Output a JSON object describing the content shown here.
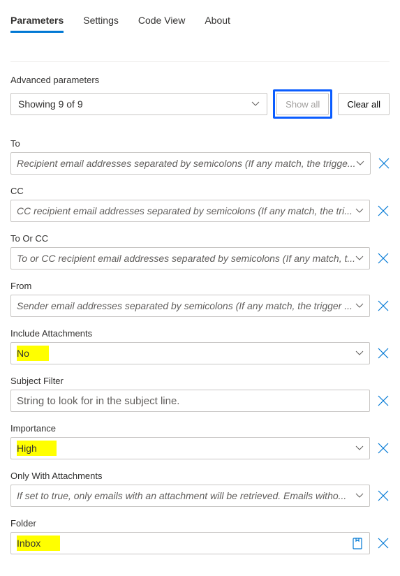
{
  "tabs": {
    "parameters": "Parameters",
    "settings": "Settings",
    "codeview": "Code View",
    "about": "About"
  },
  "advanced": {
    "label": "Advanced parameters",
    "showing": "Showing 9 of 9",
    "show_all": "Show all",
    "clear_all": "Clear all"
  },
  "fields": {
    "to": {
      "label": "To",
      "placeholder": "Recipient email addresses separated by semicolons (If any match, the trigge..."
    },
    "cc": {
      "label": "CC",
      "placeholder": "CC recipient email addresses separated by semicolons (If any match, the tri..."
    },
    "to_or_cc": {
      "label": "To Or CC",
      "placeholder": "To or CC recipient email addresses separated by semicolons (If any match, t..."
    },
    "from": {
      "label": "From",
      "placeholder": "Sender email addresses separated by semicolons (If any match, the trigger ..."
    },
    "include_attachments": {
      "label": "Include Attachments",
      "value": "No"
    },
    "subject_filter": {
      "label": "Subject Filter",
      "placeholder": "String to look for in the subject line."
    },
    "importance": {
      "label": "Importance",
      "value": "High"
    },
    "only_with_attachments": {
      "label": "Only With Attachments",
      "placeholder": "If set to true, only emails with an attachment will be retrieved. Emails witho..."
    },
    "folder": {
      "label": "Folder",
      "value": "Inbox"
    }
  }
}
